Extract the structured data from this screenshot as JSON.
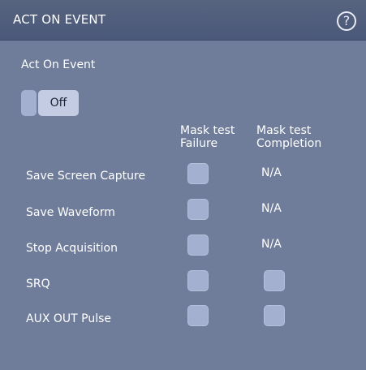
{
  "window": {
    "title": "ACT ON EVENT",
    "help_label": "?"
  },
  "act_on_event": {
    "label": "Act On Event",
    "toggle_value": "Off"
  },
  "columns": {
    "failure": [
      "Mask test",
      "Failure"
    ],
    "completion": [
      "Mask test",
      "Completion"
    ]
  },
  "rows": [
    {
      "label": "Save Screen Capture",
      "failure": "checkbox",
      "completion": "N/A"
    },
    {
      "label": "Save Waveform",
      "failure": "checkbox",
      "completion": "N/A"
    },
    {
      "label": "Stop Acquisition",
      "failure": "checkbox",
      "completion": "N/A"
    },
    {
      "label": "SRQ",
      "failure": "checkbox",
      "completion": "checkbox"
    },
    {
      "label": "AUX OUT Pulse",
      "failure": "checkbox",
      "completion": "checkbox"
    }
  ],
  "colors": {
    "background": "#6f7c9a",
    "titlebar": "#4f5c7c",
    "control": "#a4b0d0",
    "control_light": "#c3cce2"
  }
}
